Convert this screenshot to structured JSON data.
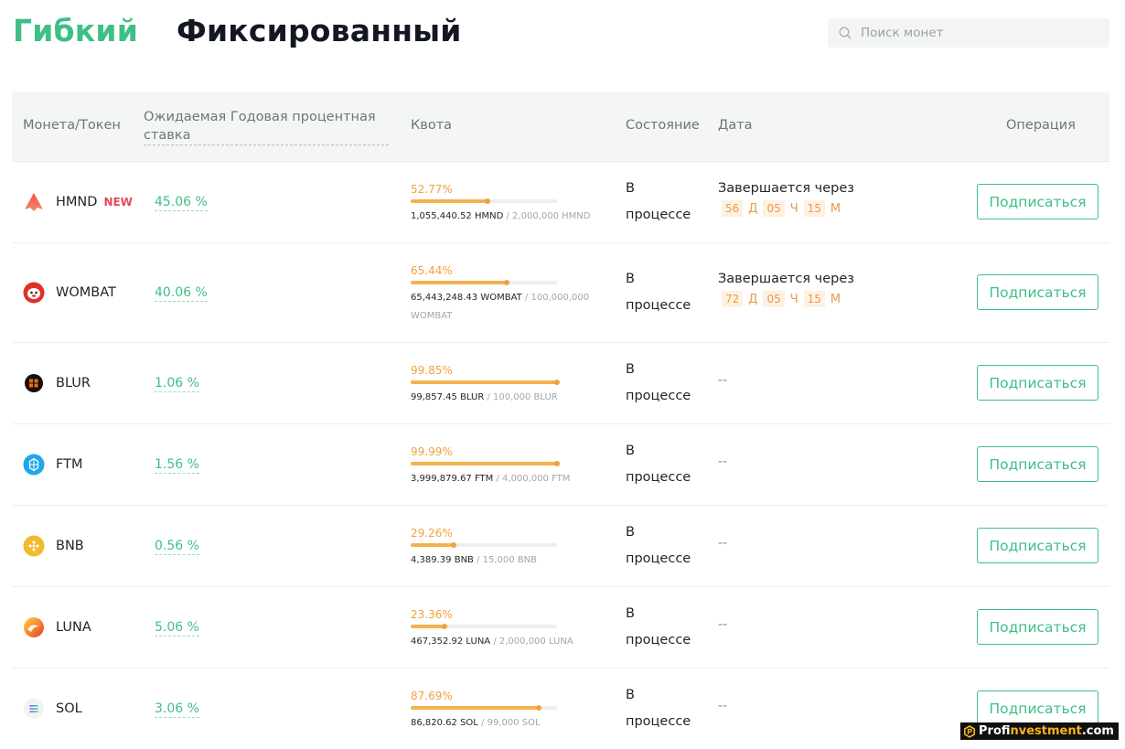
{
  "tabs": {
    "flexible": "Гибкий",
    "fixed": "Фиксированный"
  },
  "search": {
    "placeholder": "Поиск монет"
  },
  "table": {
    "headers": {
      "coin": "Монета/Токен",
      "rate": "Ожидаемая Годовая процентная ставка",
      "quota": "Квота",
      "state": "Состояние",
      "date": "Дата",
      "operation": "Операция"
    },
    "rows": [
      {
        "symbol": "HMND",
        "badge": "NEW",
        "rate": "45.06 %",
        "quota_pct": "52.77%",
        "quota_fraction": 0.5277,
        "quota_filled": "1,055,440.52 HMND",
        "quota_total": " / 2,000,000 HMND",
        "state": "В процессе",
        "date_label": "Завершается через",
        "days": "56",
        "day_unit": "Д",
        "hours": "05",
        "hour_unit": "Ч",
        "minutes": "15",
        "minute_unit": "М",
        "date_dash": "",
        "button": "Подписаться",
        "icon": "hmnd-icon"
      },
      {
        "symbol": "WOMBAT",
        "badge": "",
        "rate": "40.06 %",
        "quota_pct": "65.44%",
        "quota_fraction": 0.6544,
        "quota_filled": "65,443,248.43 WOMBAT",
        "quota_total": " / 100,000,000 WOMBAT",
        "state": "В процессе",
        "date_label": "Завершается через",
        "days": "72",
        "day_unit": "Д",
        "hours": "05",
        "hour_unit": "Ч",
        "minutes": "15",
        "minute_unit": "М",
        "date_dash": "",
        "button": "Подписаться",
        "icon": "wombat-icon"
      },
      {
        "symbol": "BLUR",
        "badge": "",
        "rate": "1.06 %",
        "quota_pct": "99.85%",
        "quota_fraction": 0.9985,
        "quota_filled": "99,857.45 BLUR",
        "quota_total": " / 100,000 BLUR",
        "state": "В процессе",
        "date_label": "",
        "days": "",
        "day_unit": "",
        "hours": "",
        "hour_unit": "",
        "minutes": "",
        "minute_unit": "",
        "date_dash": "--",
        "button": "Подписаться",
        "icon": "blur-icon"
      },
      {
        "symbol": "FTM",
        "badge": "",
        "rate": "1.56 %",
        "quota_pct": "99.99%",
        "quota_fraction": 0.9999,
        "quota_filled": "3,999,879.67 FTM",
        "quota_total": " / 4,000,000 FTM",
        "state": "В процессе",
        "date_label": "",
        "days": "",
        "day_unit": "",
        "hours": "",
        "hour_unit": "",
        "minutes": "",
        "minute_unit": "",
        "date_dash": "--",
        "button": "Подписаться",
        "icon": "ftm-icon"
      },
      {
        "symbol": "BNB",
        "badge": "",
        "rate": "0.56 %",
        "quota_pct": "29.26%",
        "quota_fraction": 0.2926,
        "quota_filled": "4,389.39 BNB",
        "quota_total": " / 15,000 BNB",
        "state": "В процессе",
        "date_label": "",
        "days": "",
        "day_unit": "",
        "hours": "",
        "hour_unit": "",
        "minutes": "",
        "minute_unit": "",
        "date_dash": "--",
        "button": "Подписаться",
        "icon": "bnb-icon"
      },
      {
        "symbol": "LUNA",
        "badge": "",
        "rate": "5.06 %",
        "quota_pct": "23.36%",
        "quota_fraction": 0.2336,
        "quota_filled": "467,352.92 LUNA",
        "quota_total": " / 2,000,000 LUNA",
        "state": "В процессе",
        "date_label": "",
        "days": "",
        "day_unit": "",
        "hours": "",
        "hour_unit": "",
        "minutes": "",
        "minute_unit": "",
        "date_dash": "--",
        "button": "Подписаться",
        "icon": "luna-icon"
      },
      {
        "symbol": "SOL",
        "badge": "",
        "rate": "3.06 %",
        "quota_pct": "87.69%",
        "quota_fraction": 0.8769,
        "quota_filled": "86,820.62 SOL",
        "quota_total": " / 99,000 SOL",
        "state": "В процессе",
        "date_label": "",
        "days": "",
        "day_unit": "",
        "hours": "",
        "hour_unit": "",
        "minutes": "",
        "minute_unit": "",
        "date_dash": "--",
        "button": "Подписаться",
        "icon": "sol-icon"
      }
    ]
  },
  "watermark": {
    "text_start": "Prof",
    "text_accent": "investment",
    "text_end": ".com"
  },
  "colors": {
    "accent": "#3ebf86",
    "badge_new": "#e8495b",
    "quota": "#f1a13e"
  }
}
